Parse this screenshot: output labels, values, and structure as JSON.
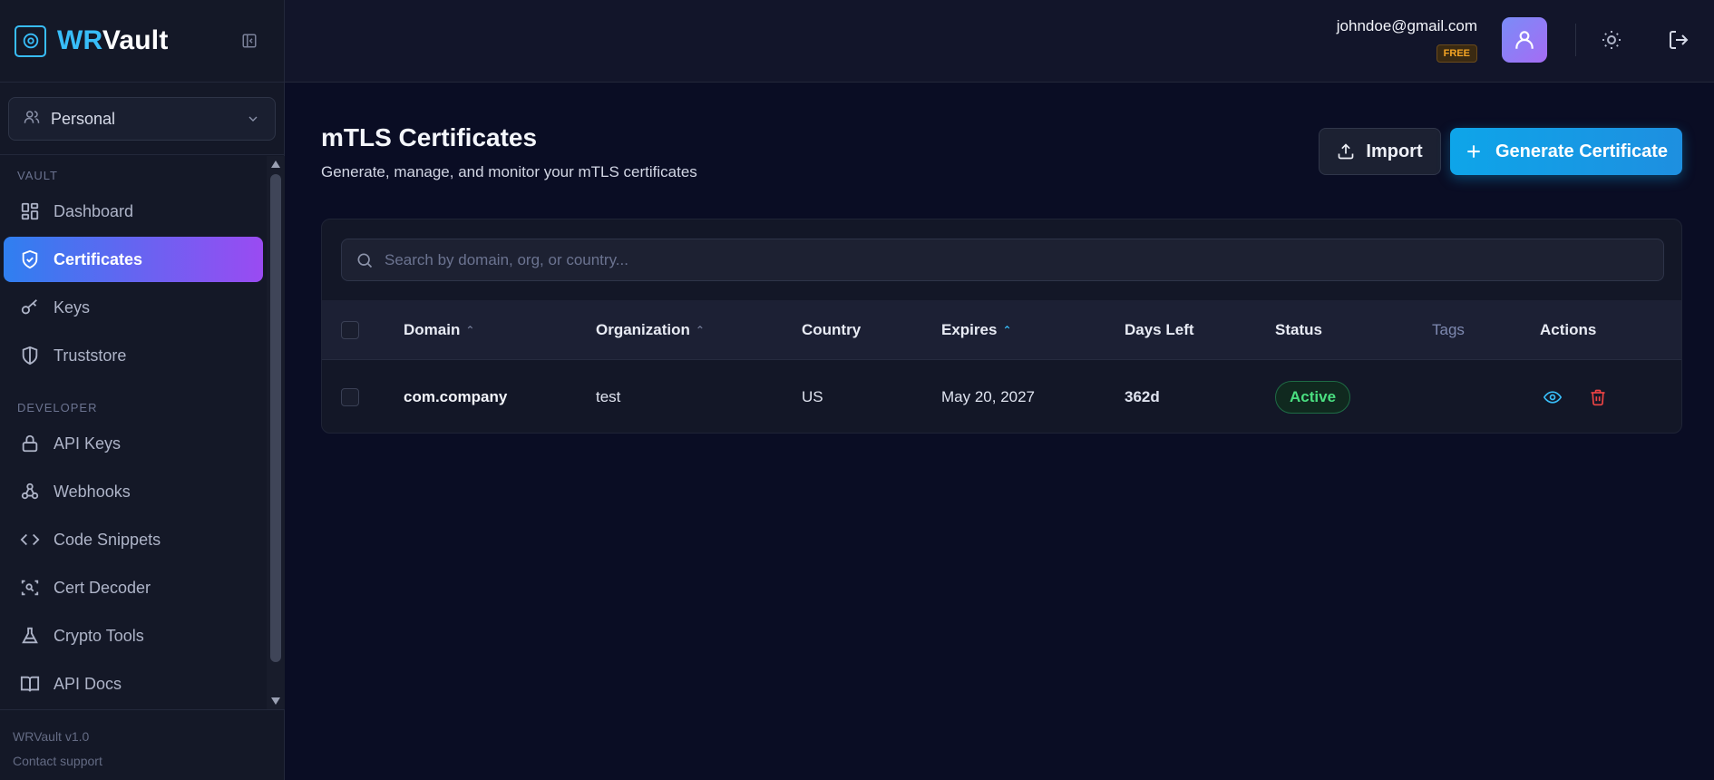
{
  "brand": {
    "name_part1": "WR",
    "name_part2": "Vault",
    "accent": "#38bdf8"
  },
  "workspace": {
    "selected": "Personal"
  },
  "sidebar": {
    "sections": [
      {
        "title": "VAULT",
        "items": [
          {
            "label": "Dashboard",
            "icon": "dashboard-icon"
          },
          {
            "label": "Certificates",
            "icon": "shield-check-icon",
            "active": true
          },
          {
            "label": "Keys",
            "icon": "key-icon"
          },
          {
            "label": "Truststore",
            "icon": "shield-icon"
          }
        ]
      },
      {
        "title": "DEVELOPER",
        "items": [
          {
            "label": "API Keys",
            "icon": "lock-icon"
          },
          {
            "label": "Webhooks",
            "icon": "webhook-icon"
          },
          {
            "label": "Code Snippets",
            "icon": "code-icon"
          },
          {
            "label": "Cert Decoder",
            "icon": "scan-icon"
          },
          {
            "label": "Crypto Tools",
            "icon": "flask-icon"
          },
          {
            "label": "API Docs",
            "icon": "book-icon"
          }
        ]
      }
    ],
    "footer": {
      "version": "WRVault v1.0",
      "support": "Contact support"
    }
  },
  "header": {
    "user_email": "johndoe@gmail.com",
    "plan": "FREE"
  },
  "main": {
    "title": "mTLS Certificates",
    "subtitle": "Generate, manage, and monitor your mTLS certificates",
    "import_label": "Import",
    "generate_label": "Generate Certificate"
  },
  "search": {
    "placeholder": "Search by domain, org, or country..."
  },
  "table": {
    "columns": [
      "Domain",
      "Organization",
      "Country",
      "Expires",
      "Days Left",
      "Status",
      "Tags",
      "Actions"
    ],
    "rows": [
      {
        "domain": "com.company",
        "organization": "test",
        "country": "US",
        "expires": "May 20, 2027",
        "days_left": "362d",
        "status": "Active",
        "tags": ""
      }
    ]
  },
  "colors": {
    "active_gradient_start": "#2f7ff0",
    "active_gradient_end": "#9a4bf2",
    "status_active": "#4ade80",
    "danger": "#ef4444"
  }
}
